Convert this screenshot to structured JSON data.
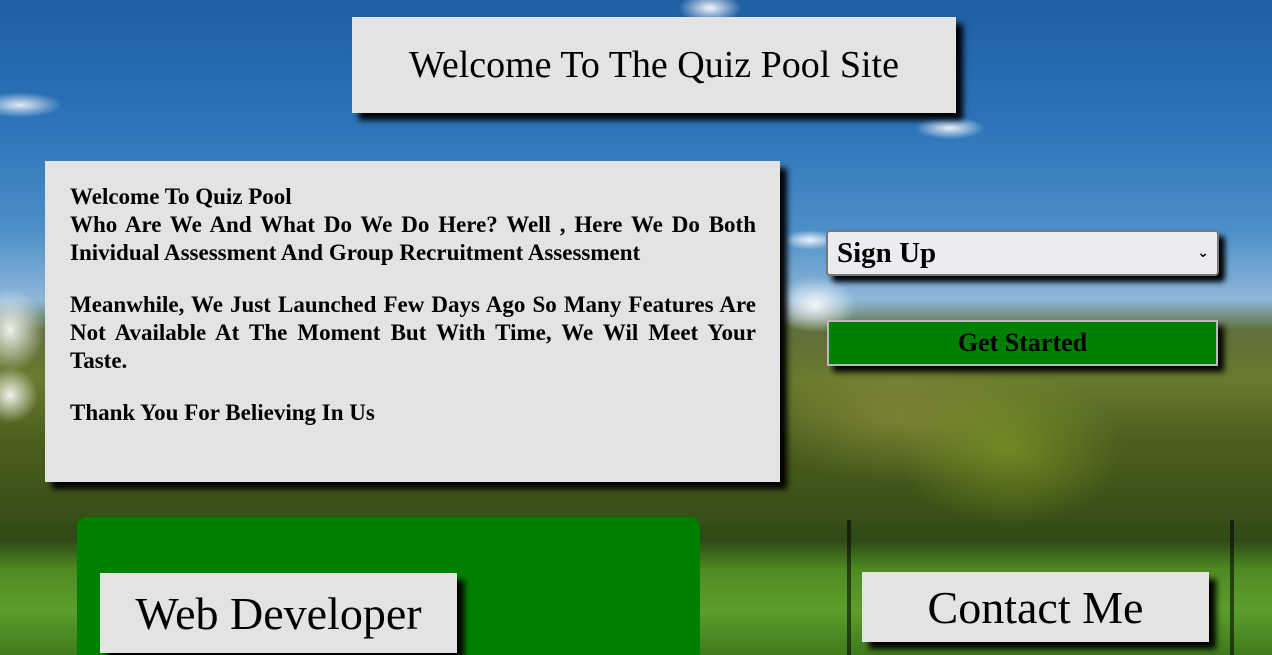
{
  "header": {
    "title": "Welcome To The Quiz Pool Site"
  },
  "intro": {
    "heading": "Welcome To Quiz Pool",
    "paragraph1": "Who Are We And What Do We Do Here? Well , Here We Do Both Inividual Assessment And Group Recruitment Assessment",
    "paragraph2": "Meanwhile, We Just Launched Few Days Ago So Many Features Are Not Available At The Moment But With Time, We Wil Meet Your Taste.",
    "paragraph3": "Thank You For Believing In Us"
  },
  "actions": {
    "select_value": "Sign Up",
    "select_icon": "chevron-down-icon",
    "get_started_label": "Get Started"
  },
  "footer": {
    "web_developer_label": "Web Developer",
    "contact_label": "Contact Me"
  },
  "colors": {
    "panel_bg": "#e3e3e3",
    "accent_green": "#008000",
    "text": "#000000"
  }
}
